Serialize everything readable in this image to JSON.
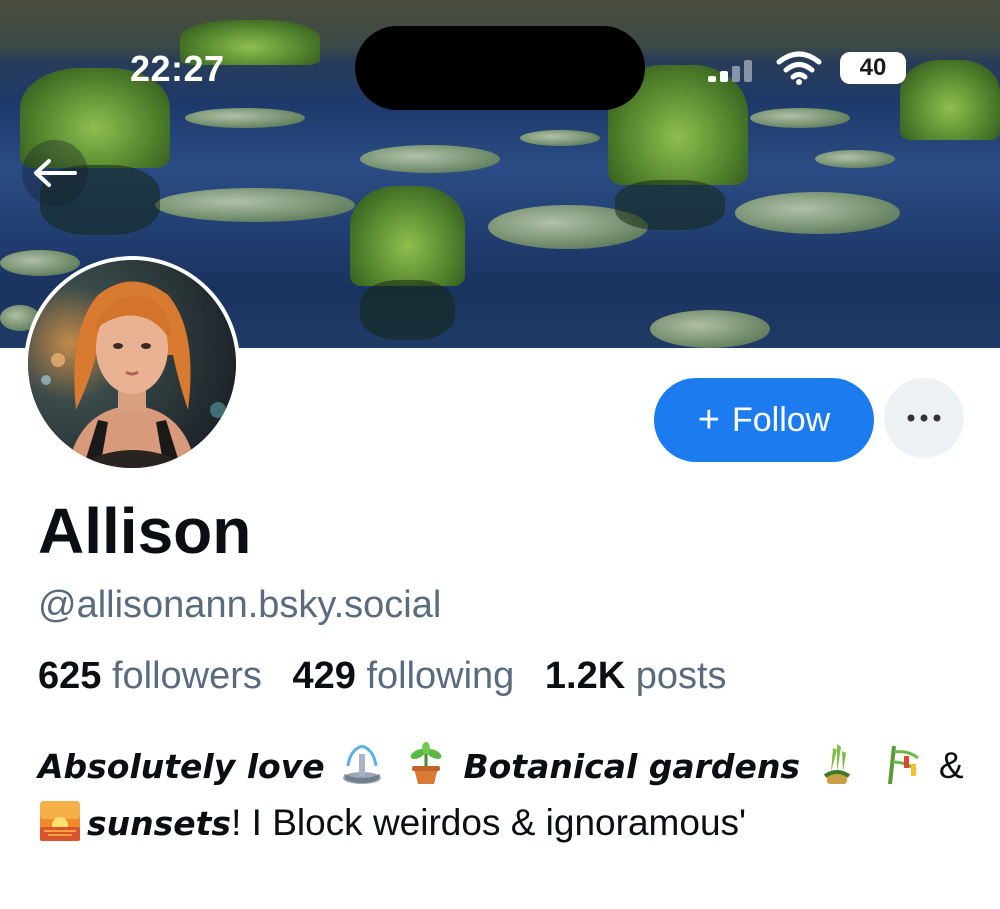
{
  "status_bar": {
    "time": "22:27",
    "battery": "40"
  },
  "profile": {
    "name": "Allison",
    "handle": "@allisonann.bsky.social",
    "follow_label": "Follow",
    "more_label": "···"
  },
  "stats": {
    "followers_count": "625",
    "followers_label": "followers",
    "following_count": "429",
    "following_label": "following",
    "posts_count": "1.2K",
    "posts_label": "posts"
  },
  "bio": {
    "part1": "Absolutely love",
    "part2": "Botanical gardens",
    "part3": "&",
    "part4": "sunsets",
    "part5": "! I Block weirdos & ignoramous'"
  },
  "colors": {
    "accent": "#1d7bf0",
    "muted_text": "#5b6b7e",
    "text": "#0b0f14"
  },
  "icons": [
    "back-arrow-icon",
    "signal-icon",
    "wifi-icon",
    "battery-icon",
    "plus-icon",
    "more-dots-icon",
    "fountain-emoji",
    "potted-plant-emoji",
    "kadomatsu-emoji",
    "tanabata-tree-emoji",
    "sunset-emoji"
  ]
}
